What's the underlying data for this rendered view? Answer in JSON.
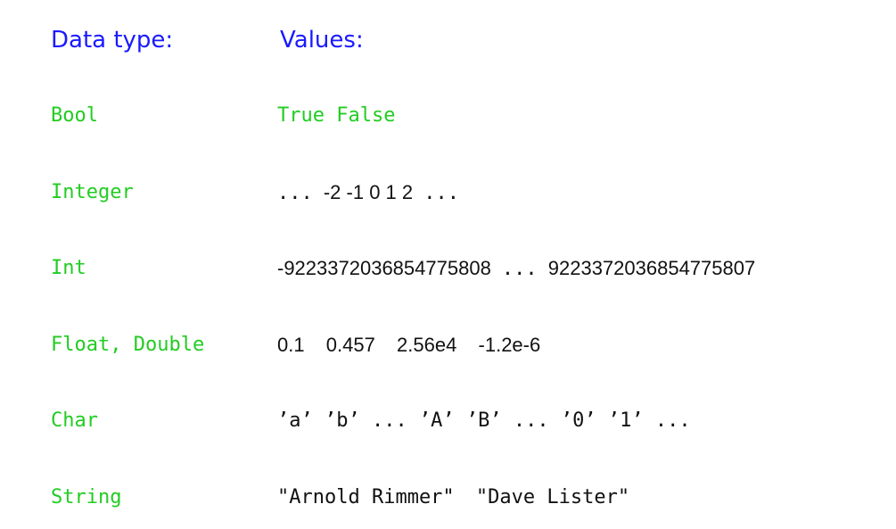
{
  "headers": {
    "data_type": "Data type:",
    "values": "Values:"
  },
  "rows": [
    {
      "type": "Bool",
      "values": "True False"
    },
    {
      "type": "Integer",
      "values_parts": [
        "...",
        "-2 -1 0 1 2",
        "..."
      ]
    },
    {
      "type": "Int",
      "values_parts": [
        "-9223372036854775808",
        "...",
        "9223372036854775807"
      ]
    },
    {
      "type": "Float, Double",
      "values_parts": [
        "0.1",
        "0.457",
        "2.56e4",
        "-1.2e-6"
      ]
    },
    {
      "type": "Char",
      "values": "’a’ ’b’ ... ’A’ ’B’ ... ’0’ ’1’ ..."
    },
    {
      "type": "String",
      "values_parts": [
        "\"Arnold Rimmer\"",
        "\"Dave Lister\""
      ]
    }
  ],
  "colors": {
    "header": "#1a1aff",
    "type": "#22cc22",
    "values": "#111111"
  }
}
